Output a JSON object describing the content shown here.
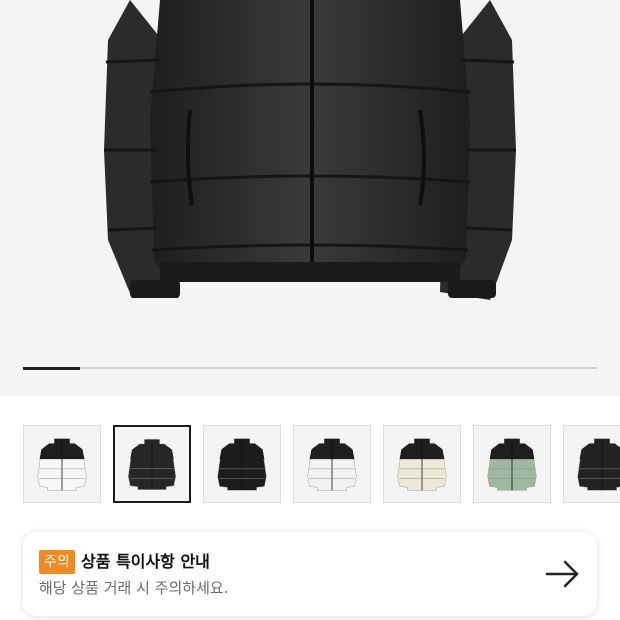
{
  "gallery": {
    "main_image": "black-puffer-jacket-image",
    "progress": 0.1,
    "thumbnails": [
      {
        "name": "white-black-jacket",
        "selected": false,
        "body": "#f7f7f7",
        "yoke": "#1e1e1e"
      },
      {
        "name": "black-matte-jacket",
        "selected": true,
        "body": "#262626",
        "yoke": "#262626"
      },
      {
        "name": "black-shiny-jacket",
        "selected": false,
        "body": "#1c1c1c",
        "yoke": "#1c1c1c"
      },
      {
        "name": "white-black-jacket-2",
        "selected": false,
        "body": "#f2f2f2",
        "yoke": "#1e1e1e"
      },
      {
        "name": "cream-black-jacket",
        "selected": false,
        "body": "#efe8d6",
        "yoke": "#1e1e1e"
      },
      {
        "name": "sage-black-jacket",
        "selected": false,
        "body": "#9fb9a0",
        "yoke": "#1e1e1e"
      },
      {
        "name": "black-jacket-2",
        "selected": false,
        "body": "#222222",
        "yoke": "#222222"
      }
    ]
  },
  "notice": {
    "badge": "주의",
    "title": "상품 특이사항 안내",
    "description": "해당 상품 거래 시 주의하세요.",
    "arrow_icon": "arrow-right-icon",
    "badge_color": "#f08a24"
  }
}
